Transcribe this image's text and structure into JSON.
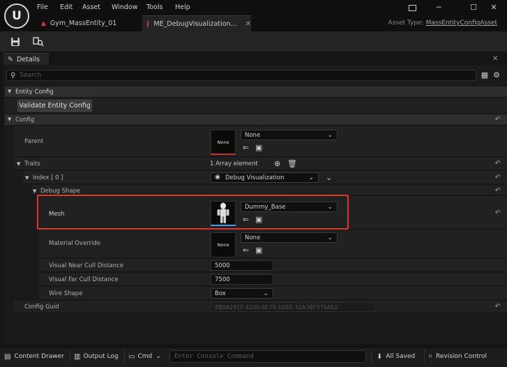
{
  "window": {
    "logo": "U",
    "menu": [
      "File",
      "Edit",
      "Asset",
      "Window",
      "Tools",
      "Help"
    ],
    "tabs": [
      {
        "label": "Gym_MassEntity_01",
        "active": false
      },
      {
        "label": "ME_DebugVisualization...",
        "active": true
      }
    ],
    "tab_close": "✕",
    "asset_type_label": "Asset Type:",
    "asset_type_value": "MassEntityConfigAsset"
  },
  "details": {
    "tab_label": "Details",
    "tab_close": "✕",
    "search_placeholder": "Search",
    "entity_config_header": "Entity Config",
    "validate_button": "Validate Entity Config",
    "config_header": "Config",
    "parent_label": "Parent",
    "parent_thumb": "None",
    "parent_value": "None",
    "traits_label": "Traits",
    "traits_count": "1 Array element",
    "index_label": "Index [ 0 ]",
    "index_value": "Debug Visualization",
    "debug_shape_label": "Debug Shape",
    "mesh_label": "Mesh",
    "mesh_value": "Dummy_Base",
    "material_label": "Material Override",
    "material_thumb": "None",
    "material_value": "None",
    "near_cull_label": "Visual Near Cull Distance",
    "near_cull_value": "5000",
    "far_cull_label": "Visual Far Cull Distance",
    "far_cull_value": "7500",
    "wire_shape_label": "Wire Shape",
    "wire_shape_value": "Box",
    "config_guid_label": "Config Guid",
    "config_guid_value": "8B0A291F-4206-8E79-1DEE-32A3BF379A52"
  },
  "statusbar": {
    "content_drawer": "Content Drawer",
    "output_log": "Output Log",
    "cmd": "Cmd",
    "console_placeholder": "Enter Console Command",
    "all_saved": "All Saved",
    "revision_control": "Revision Control"
  },
  "colors": {
    "highlight": "#e0352f",
    "accent_red": "#d23a3a"
  }
}
